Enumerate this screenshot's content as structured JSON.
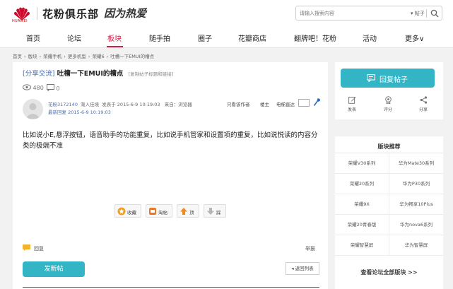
{
  "header": {
    "logo_text": "HUAWEI",
    "brand": "花粉俱乐部",
    "slogan": "因为热爱",
    "search_placeholder": "请输入搜索内容",
    "search_scope": "帖子",
    "search_scope_arrow": "▾"
  },
  "nav": {
    "items": [
      "首页",
      "论坛",
      "板块",
      "随手拍",
      "圈子",
      "花瓣商店",
      "翻牌吧！花粉",
      "活动",
      "更多∨"
    ]
  },
  "breadcrumb": [
    "首页",
    "›",
    "版块",
    "›",
    "荣耀手机",
    "›",
    "更多机型",
    "›",
    "荣耀6",
    "›",
    "吐槽一下EMUI的槽点"
  ],
  "post": {
    "category": "[分享交流]",
    "title": "吐槽一下EMUI的槽点",
    "copy_link": "[复制帖子标题和链接]",
    "views": "480",
    "replies": "0",
    "author": "花粉3172140",
    "level": "渐入佳境",
    "published": "发表于 2015-6-9 10:19:03",
    "source": "来自：浏览器",
    "last_reply_label": "最新回复",
    "last_reply_time": "2015-6-9 10:19:03",
    "only_author": "只看该作者",
    "floor": "楼主",
    "e_reader": "电梯直达",
    "body": "比如说小E,悬浮按钮，语音助手的功能重复，比如说手机管家和设置项的重复，比如说悦读的内容分类的极端不准",
    "actions": {
      "fav": "收藏",
      "share": "淘帖",
      "up": "顶",
      "down": "踩"
    },
    "reply": "回复",
    "report": "举报",
    "new_post": "发新帖",
    "back_list": "返回列表"
  },
  "sidebar": {
    "reply_button": "回复帖子",
    "mini": {
      "post": "发表",
      "rate": "评分",
      "share": "分享"
    },
    "rec_title": "版块推荐",
    "rec_items": [
      "荣耀V30系列",
      "华为Mate30系列",
      "荣耀20系列",
      "华为P30系列",
      "荣耀9X",
      "华为畅享10Plus",
      "荣耀20青春版",
      "华为nova6系列",
      "荣耀智慧屏",
      "华为智慧屏"
    ],
    "rec_all": "查看论坛全部版块 >>"
  },
  "colors": {
    "accent": "#d6204a",
    "teal": "#33b5c6",
    "link": "#4a6ea9"
  }
}
